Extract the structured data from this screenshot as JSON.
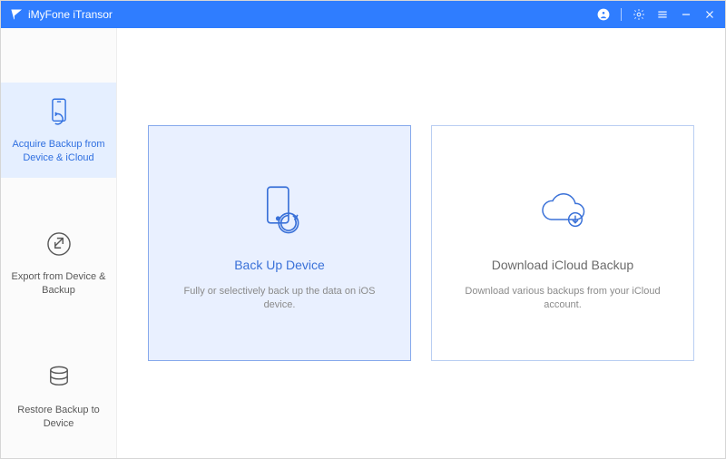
{
  "app": {
    "title": "iMyFone iTransor"
  },
  "sidebar": {
    "items": [
      {
        "label": "Acquire Backup from Device & iCloud",
        "icon": "phone-refresh-icon"
      },
      {
        "label": "Export from Device & Backup",
        "icon": "export-icon"
      },
      {
        "label": "Restore Backup to Device",
        "icon": "database-icon"
      }
    ]
  },
  "cards": [
    {
      "title": "Back Up Device",
      "desc": "Fully or selectively back up the data on iOS device.",
      "icon": "device-backup-icon"
    },
    {
      "title": "Download iCloud Backup",
      "desc": "Download various backups from your iCloud account.",
      "icon": "cloud-download-icon"
    }
  ],
  "colors": {
    "accent": "#2f7dff"
  }
}
